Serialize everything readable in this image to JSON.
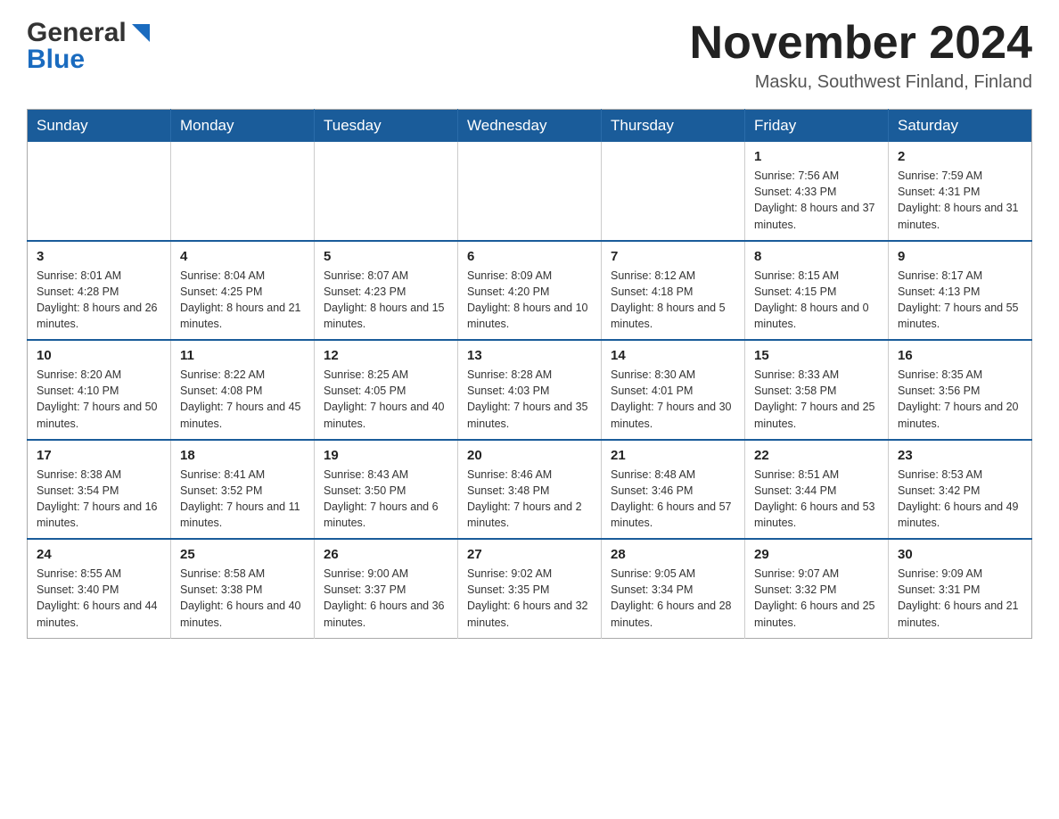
{
  "header": {
    "logo_line1": "General",
    "logo_line2": "Blue",
    "month_title": "November 2024",
    "subtitle": "Masku, Southwest Finland, Finland"
  },
  "weekdays": [
    "Sunday",
    "Monday",
    "Tuesday",
    "Wednesday",
    "Thursday",
    "Friday",
    "Saturday"
  ],
  "weeks": [
    [
      {
        "day": "",
        "info": ""
      },
      {
        "day": "",
        "info": ""
      },
      {
        "day": "",
        "info": ""
      },
      {
        "day": "",
        "info": ""
      },
      {
        "day": "",
        "info": ""
      },
      {
        "day": "1",
        "info": "Sunrise: 7:56 AM\nSunset: 4:33 PM\nDaylight: 8 hours\nand 37 minutes."
      },
      {
        "day": "2",
        "info": "Sunrise: 7:59 AM\nSunset: 4:31 PM\nDaylight: 8 hours\nand 31 minutes."
      }
    ],
    [
      {
        "day": "3",
        "info": "Sunrise: 8:01 AM\nSunset: 4:28 PM\nDaylight: 8 hours\nand 26 minutes."
      },
      {
        "day": "4",
        "info": "Sunrise: 8:04 AM\nSunset: 4:25 PM\nDaylight: 8 hours\nand 21 minutes."
      },
      {
        "day": "5",
        "info": "Sunrise: 8:07 AM\nSunset: 4:23 PM\nDaylight: 8 hours\nand 15 minutes."
      },
      {
        "day": "6",
        "info": "Sunrise: 8:09 AM\nSunset: 4:20 PM\nDaylight: 8 hours\nand 10 minutes."
      },
      {
        "day": "7",
        "info": "Sunrise: 8:12 AM\nSunset: 4:18 PM\nDaylight: 8 hours\nand 5 minutes."
      },
      {
        "day": "8",
        "info": "Sunrise: 8:15 AM\nSunset: 4:15 PM\nDaylight: 8 hours\nand 0 minutes."
      },
      {
        "day": "9",
        "info": "Sunrise: 8:17 AM\nSunset: 4:13 PM\nDaylight: 7 hours\nand 55 minutes."
      }
    ],
    [
      {
        "day": "10",
        "info": "Sunrise: 8:20 AM\nSunset: 4:10 PM\nDaylight: 7 hours\nand 50 minutes."
      },
      {
        "day": "11",
        "info": "Sunrise: 8:22 AM\nSunset: 4:08 PM\nDaylight: 7 hours\nand 45 minutes."
      },
      {
        "day": "12",
        "info": "Sunrise: 8:25 AM\nSunset: 4:05 PM\nDaylight: 7 hours\nand 40 minutes."
      },
      {
        "day": "13",
        "info": "Sunrise: 8:28 AM\nSunset: 4:03 PM\nDaylight: 7 hours\nand 35 minutes."
      },
      {
        "day": "14",
        "info": "Sunrise: 8:30 AM\nSunset: 4:01 PM\nDaylight: 7 hours\nand 30 minutes."
      },
      {
        "day": "15",
        "info": "Sunrise: 8:33 AM\nSunset: 3:58 PM\nDaylight: 7 hours\nand 25 minutes."
      },
      {
        "day": "16",
        "info": "Sunrise: 8:35 AM\nSunset: 3:56 PM\nDaylight: 7 hours\nand 20 minutes."
      }
    ],
    [
      {
        "day": "17",
        "info": "Sunrise: 8:38 AM\nSunset: 3:54 PM\nDaylight: 7 hours\nand 16 minutes."
      },
      {
        "day": "18",
        "info": "Sunrise: 8:41 AM\nSunset: 3:52 PM\nDaylight: 7 hours\nand 11 minutes."
      },
      {
        "day": "19",
        "info": "Sunrise: 8:43 AM\nSunset: 3:50 PM\nDaylight: 7 hours\nand 6 minutes."
      },
      {
        "day": "20",
        "info": "Sunrise: 8:46 AM\nSunset: 3:48 PM\nDaylight: 7 hours\nand 2 minutes."
      },
      {
        "day": "21",
        "info": "Sunrise: 8:48 AM\nSunset: 3:46 PM\nDaylight: 6 hours\nand 57 minutes."
      },
      {
        "day": "22",
        "info": "Sunrise: 8:51 AM\nSunset: 3:44 PM\nDaylight: 6 hours\nand 53 minutes."
      },
      {
        "day": "23",
        "info": "Sunrise: 8:53 AM\nSunset: 3:42 PM\nDaylight: 6 hours\nand 49 minutes."
      }
    ],
    [
      {
        "day": "24",
        "info": "Sunrise: 8:55 AM\nSunset: 3:40 PM\nDaylight: 6 hours\nand 44 minutes."
      },
      {
        "day": "25",
        "info": "Sunrise: 8:58 AM\nSunset: 3:38 PM\nDaylight: 6 hours\nand 40 minutes."
      },
      {
        "day": "26",
        "info": "Sunrise: 9:00 AM\nSunset: 3:37 PM\nDaylight: 6 hours\nand 36 minutes."
      },
      {
        "day": "27",
        "info": "Sunrise: 9:02 AM\nSunset: 3:35 PM\nDaylight: 6 hours\nand 32 minutes."
      },
      {
        "day": "28",
        "info": "Sunrise: 9:05 AM\nSunset: 3:34 PM\nDaylight: 6 hours\nand 28 minutes."
      },
      {
        "day": "29",
        "info": "Sunrise: 9:07 AM\nSunset: 3:32 PM\nDaylight: 6 hours\nand 25 minutes."
      },
      {
        "day": "30",
        "info": "Sunrise: 9:09 AM\nSunset: 3:31 PM\nDaylight: 6 hours\nand 21 minutes."
      }
    ]
  ]
}
